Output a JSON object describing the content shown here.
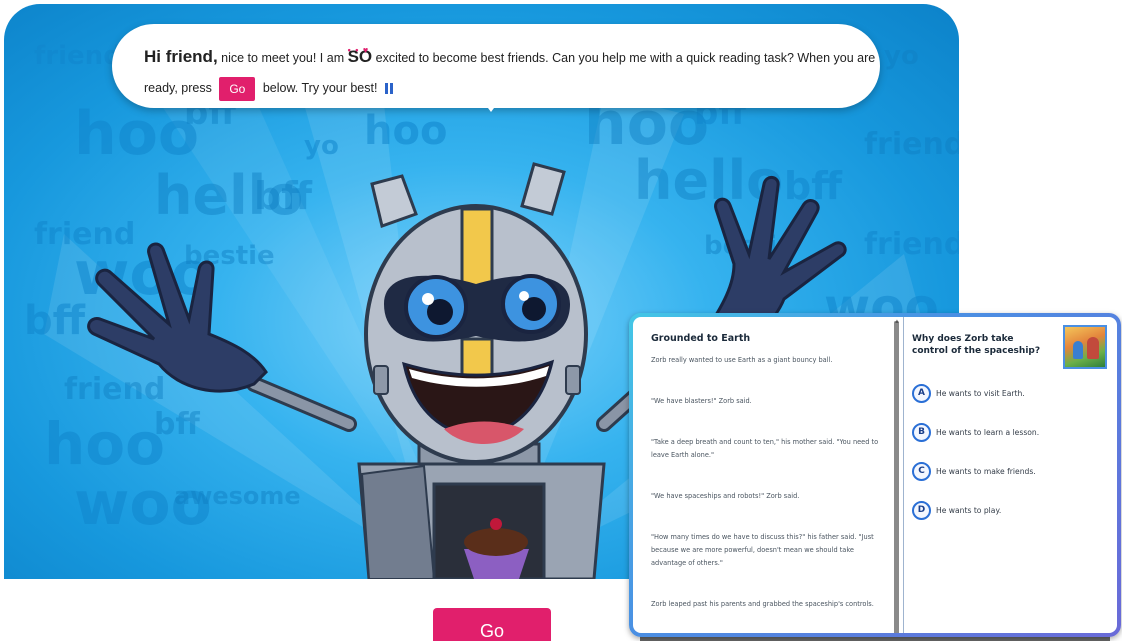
{
  "speech": {
    "greeting": "Hi friend,",
    "text_before_so": " nice to meet you! I am ",
    "so_word": "SO",
    "text_after_so": " excited to become best friends. Can you help me with a quick reading task? When you are",
    "ready_press": "ready, press ",
    "go_label": "Go",
    "after_go": " below. Try your best!"
  },
  "main_button": {
    "label": "Go"
  },
  "background_words": [
    "hoo",
    "bff",
    "yo",
    "hello",
    "friend",
    "woo",
    "bestie",
    "awesome"
  ],
  "passage": {
    "title": "Grounded to Earth",
    "paragraphs": [
      "Zorb really wanted to use Earth as a giant bouncy ball.",
      "\"We have blasters!\" Zorb said.",
      "\"Take a deep breath and count to ten,\" his mother said. \"You need to leave Earth alone.\"",
      "\"We have spaceships and robots!\" Zorb said.",
      "\"How many times do we have to discuss this?\" his father said. \"Just because we are more powerful, doesn't mean we should take advantage of others.\"",
      "Zorb leaped past his parents and grabbed the spaceship's controls."
    ]
  },
  "question": {
    "text": "Why does Zorb take control of the spaceship?",
    "options": [
      {
        "letter": "A",
        "text": "He wants to visit Earth."
      },
      {
        "letter": "B",
        "text": "He wants to learn a lesson."
      },
      {
        "letter": "C",
        "text": "He wants to make friends."
      },
      {
        "letter": "D",
        "text": "He wants to play."
      }
    ]
  },
  "colors": {
    "accent_pink": "#e11f6c",
    "sky_blue": "#1798dd",
    "option_blue": "#2a6fd6",
    "card_gradient_start": "#43c7e6",
    "card_gradient_end": "#6a6ad8"
  }
}
